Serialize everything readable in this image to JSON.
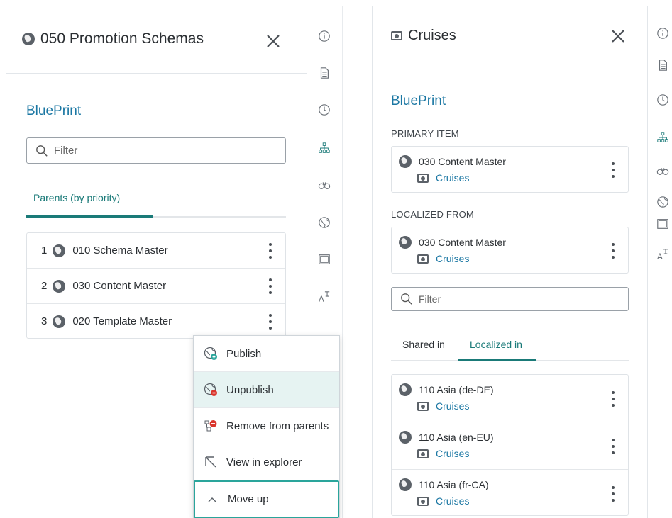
{
  "left": {
    "title": "050 Promotion Schemas",
    "section": "BluePrint",
    "filter_placeholder": "Filter",
    "tab": "Parents (by priority)",
    "parents": [
      {
        "num": "1",
        "name": "010 Schema Master"
      },
      {
        "num": "2",
        "name": "030 Content Master"
      },
      {
        "num": "3",
        "name": "020 Template Master"
      }
    ],
    "menu": [
      {
        "label": "Publish",
        "icon": "publish-icon"
      },
      {
        "label": "Unpublish",
        "icon": "unpublish-icon"
      },
      {
        "label": "Remove from parents",
        "icon": "remove-from-parents-icon"
      },
      {
        "label": "View in explorer",
        "icon": "view-in-explorer-icon"
      },
      {
        "label": "Move up",
        "icon": "chevron-up-icon"
      }
    ]
  },
  "right": {
    "title": "Cruises",
    "section": "BluePrint",
    "primary_label": "PRIMARY ITEM",
    "primary": {
      "pub": "030 Content Master",
      "item": "Cruises"
    },
    "localized_label": "LOCALIZED FROM",
    "localized": {
      "pub": "030 Content Master",
      "item": "Cruises"
    },
    "filter_placeholder": "Filter",
    "tabs": [
      "Shared in",
      "Localized in"
    ],
    "localized_in": [
      {
        "pub": "110 Asia (de-DE)",
        "item": "Cruises"
      },
      {
        "pub": "110 Asia (en-EU)",
        "item": "Cruises"
      },
      {
        "pub": "110 Asia (fr-CA)",
        "item": "Cruises"
      }
    ]
  },
  "rail_icons": [
    "info-icon",
    "document-icon",
    "clock-icon",
    "hierarchy-icon",
    "binoculars-icon",
    "globe-icon",
    "window-icon",
    "translate-icon"
  ],
  "colors": {
    "accent": "#1a7a78",
    "link": "#1b77a3",
    "menu_hover": "#e6f3f2",
    "focus_border": "#2aa59b"
  }
}
